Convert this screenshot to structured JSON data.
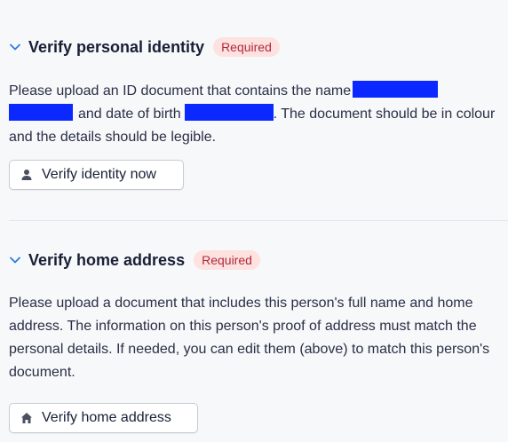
{
  "sections": [
    {
      "title": "Verify personal identity",
      "badge": "Required",
      "text_part1": "Please upload an ID document that contains the name",
      "text_part2": "and date of birth",
      "text_part3": ". The document should be in colour and the details should be legible.",
      "button_label": "Verify identity now",
      "button_icon": "person-icon"
    },
    {
      "title": "Verify home address",
      "badge": "Required",
      "text": "Please upload a document that includes this person's full name and home address. The information on this person's proof of address must match the personal details. If needed, you can edit them (above) to match this person's document.",
      "button_label": "Verify home address",
      "button_icon": "home-icon"
    }
  ],
  "colors": {
    "accent": "#1f6fe0",
    "badge_bg": "#fde2df",
    "badge_text": "#b2283d",
    "redaction": "#0a28ff"
  }
}
